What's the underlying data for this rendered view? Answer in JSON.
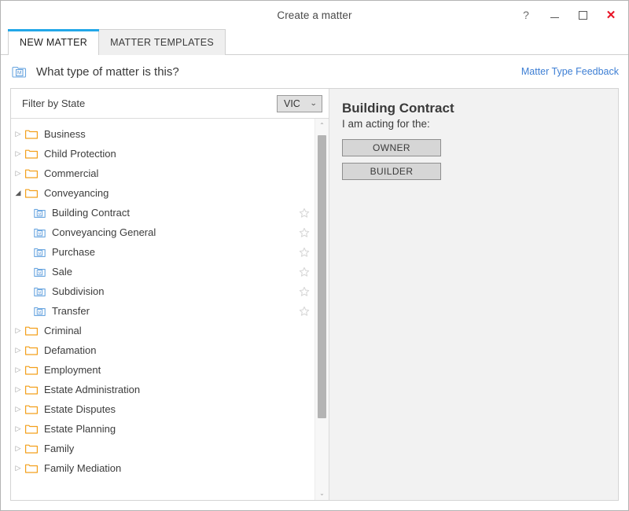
{
  "window": {
    "title": "Create a matter",
    "controls": [
      {
        "name": "help-button",
        "glyph": "?"
      },
      {
        "name": "minimize-button",
        "glyph": "minimize"
      },
      {
        "name": "maximize-button",
        "glyph": "maximize"
      },
      {
        "name": "close-button",
        "glyph": "✕"
      }
    ]
  },
  "tabs": [
    {
      "label": "NEW MATTER",
      "active": true
    },
    {
      "label": "MATTER TEMPLATES",
      "active": false
    }
  ],
  "header": {
    "icon": "matter-folder-icon",
    "question": "What type of matter is this?",
    "feedback_link": "Matter Type Feedback"
  },
  "filter": {
    "label": "Filter by State",
    "state_value": "VIC",
    "chevron": "⌄"
  },
  "tree": {
    "items": [
      {
        "label": "Business",
        "type": "folder",
        "expanded": false,
        "level": 0
      },
      {
        "label": "Child Protection",
        "type": "folder",
        "expanded": false,
        "level": 0
      },
      {
        "label": "Commercial",
        "type": "folder",
        "expanded": false,
        "level": 0
      },
      {
        "label": "Conveyancing",
        "type": "folder",
        "expanded": true,
        "level": 0
      },
      {
        "label": "Building Contract",
        "type": "matter",
        "level": 1,
        "favorite": false,
        "selected": true
      },
      {
        "label": "Conveyancing General",
        "type": "matter",
        "level": 1,
        "favorite": false
      },
      {
        "label": "Purchase",
        "type": "matter",
        "level": 1,
        "favorite": false
      },
      {
        "label": "Sale",
        "type": "matter",
        "level": 1,
        "favorite": false
      },
      {
        "label": "Subdivision",
        "type": "matter",
        "level": 1,
        "favorite": false
      },
      {
        "label": "Transfer",
        "type": "matter",
        "level": 1,
        "favorite": false
      },
      {
        "label": "Criminal",
        "type": "folder",
        "expanded": false,
        "level": 0
      },
      {
        "label": "Defamation",
        "type": "folder",
        "expanded": false,
        "level": 0
      },
      {
        "label": "Employment",
        "type": "folder",
        "expanded": false,
        "level": 0
      },
      {
        "label": "Estate Administration",
        "type": "folder",
        "expanded": false,
        "level": 0
      },
      {
        "label": "Estate Disputes",
        "type": "folder",
        "expanded": false,
        "level": 0
      },
      {
        "label": "Estate Planning",
        "type": "folder",
        "expanded": false,
        "level": 0
      },
      {
        "label": "Family",
        "type": "folder",
        "expanded": false,
        "level": 0
      },
      {
        "label": "Family Mediation",
        "type": "folder",
        "expanded": false,
        "level": 0
      }
    ],
    "expander_collapsed_glyph": "▷",
    "expander_expanded_glyph": "◢"
  },
  "detail": {
    "title": "Building Contract",
    "prompt": "I am acting for the:",
    "roles": [
      {
        "label": "OWNER"
      },
      {
        "label": "BUILDER"
      }
    ]
  },
  "scrollbar": {
    "up_glyph": "⌃",
    "down_glyph": "⌄"
  },
  "colors": {
    "accent": "#22a7e8",
    "link": "#3e7fd4",
    "folder": "#f3a01c",
    "matter_icon": "#6aa6e0",
    "close": "#e81123",
    "right_panel_bg": "#f2f2f2"
  }
}
